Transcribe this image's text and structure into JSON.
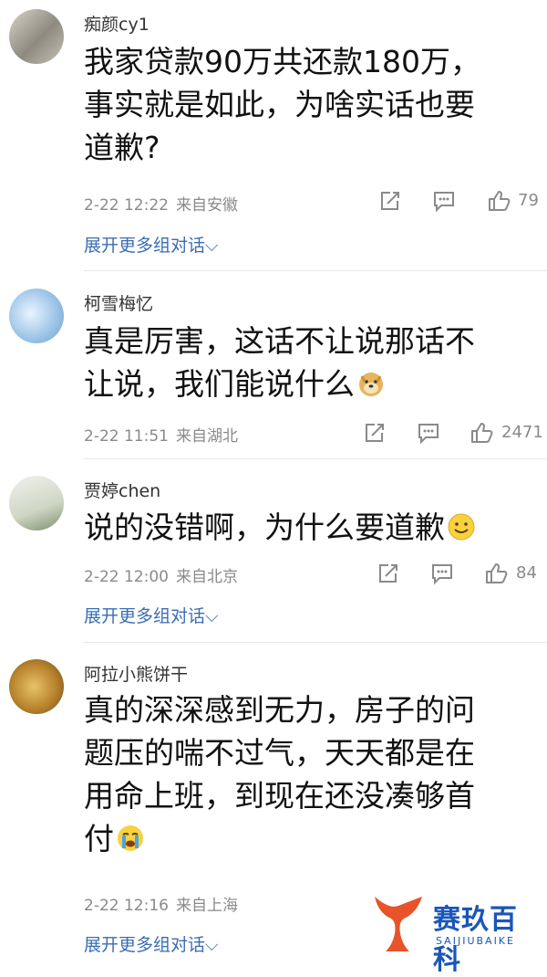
{
  "comments": [
    {
      "username": "痴颜cy1",
      "lines": [
        "我家贷款90万共还款180万，",
        "事实就是如此，为啥实话也要",
        "道歉?"
      ],
      "date": "2-22 12:22",
      "location": "来自安徽",
      "likes": "79",
      "expand": "展开更多组对话"
    },
    {
      "username": "柯雪梅忆",
      "lines": [
        "真是厉害，这话不让说那话不",
        "让说，我们能说什么"
      ],
      "date": "2-22 11:51",
      "location": "来自湖北",
      "likes": "2471",
      "emoji": "doge-emoji"
    },
    {
      "username": "贾婷chen",
      "lines": [
        "说的没错啊，为什么要道歉"
      ],
      "date": "2-22 12:00",
      "location": "来自北京",
      "likes": "84",
      "expand": "展开更多组对话",
      "emoji": "smile-emoji"
    },
    {
      "username": "阿拉小熊饼干",
      "lines": [
        "真的深深感到无力，房子的问",
        "题压的喘不过气，天天都是在",
        "用命上班，到现在还没凑够首",
        "付"
      ],
      "date": "2-22 12:16",
      "location": "来自上海",
      "expand": "展开更多组对话",
      "emoji": "crying-emoji"
    }
  ],
  "watermark": {
    "title": "赛玖百科",
    "subtitle": "SAIJIUBAIKE"
  }
}
